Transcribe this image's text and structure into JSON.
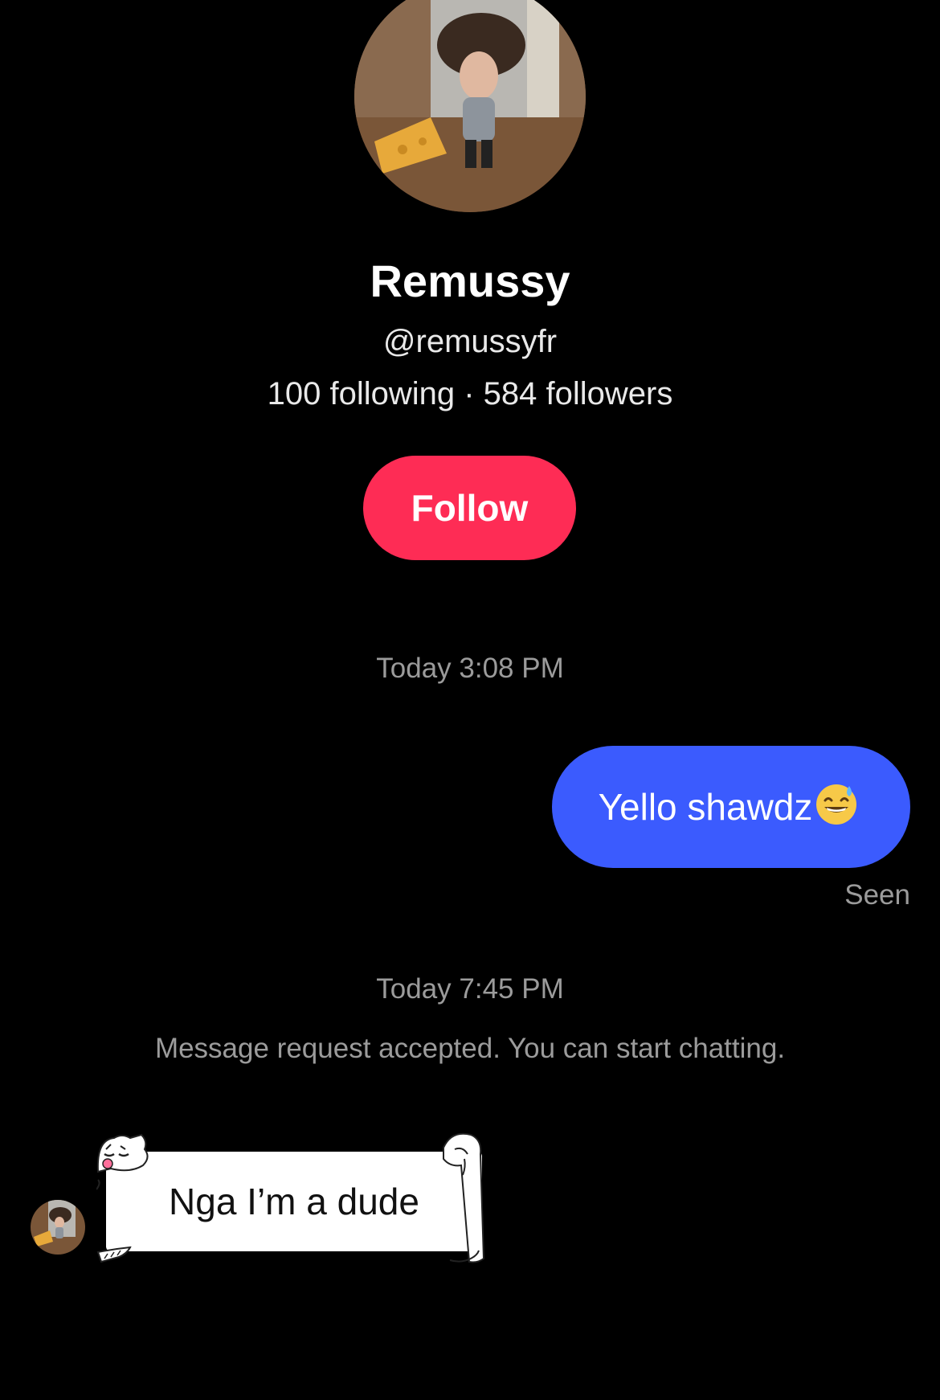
{
  "profile": {
    "display_name": "Remussy",
    "username": "@remussyfr",
    "stats": "100 following · 584 followers",
    "follow_label": "Follow",
    "follow_color": "#fe2c55"
  },
  "conversation": {
    "timestamp_1": "Today 3:08 PM",
    "outgoing_message": "Yello shawdz",
    "outgoing_emoji": "grinning-sweat-emoji",
    "outgoing_color": "#3b5bfe",
    "seen_label": "Seen",
    "timestamp_2": "Today 7:45 PM",
    "system_message": "Message request accepted. You can start chatting.",
    "incoming_message": "Nga I’m a dude"
  }
}
